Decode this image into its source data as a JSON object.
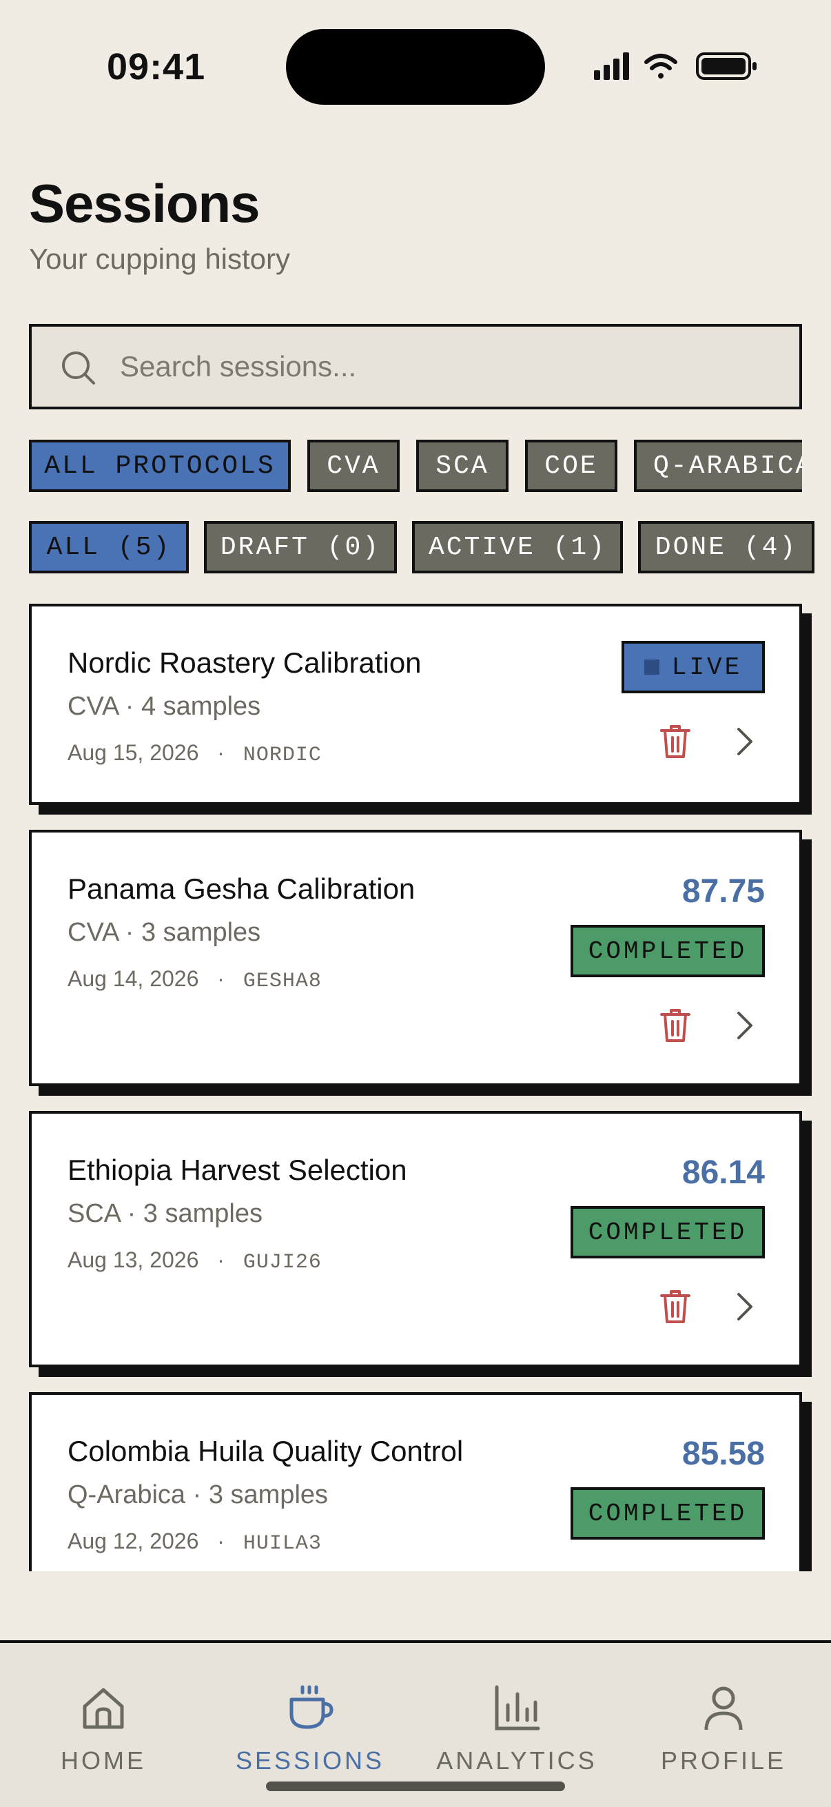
{
  "status_bar": {
    "time": "09:41"
  },
  "header": {
    "title": "Sessions",
    "subtitle": "Your cupping history"
  },
  "search": {
    "placeholder": "Search sessions..."
  },
  "protocol_filters": [
    "ALL PROTOCOLS",
    "CVA",
    "SCA",
    "COE",
    "Q-ARABICA"
  ],
  "status_filters": [
    "ALL (5)",
    "DRAFT (0)",
    "ACTIVE (1)",
    "DONE (4)"
  ],
  "sessions": [
    {
      "title": "Nordic Roastery Calibration",
      "meta": "CVA · 4 samples",
      "date": "Aug 15, 2026",
      "code": "NORDIC",
      "status": "LIVE",
      "score": ""
    },
    {
      "title": "Panama Gesha Calibration",
      "meta": "CVA · 3 samples",
      "date": "Aug 14, 2026",
      "code": "GESHA8",
      "status": "COMPLETED",
      "score": "87.75"
    },
    {
      "title": "Ethiopia Harvest Selection",
      "meta": "SCA · 3 samples",
      "date": "Aug 13, 2026",
      "code": "GUJI26",
      "status": "COMPLETED",
      "score": "86.14"
    },
    {
      "title": "Colombia Huila Quality Control",
      "meta": "Q-Arabica · 3 samples",
      "date": "Aug 12, 2026",
      "code": "HUILA3",
      "status": "COMPLETED",
      "score": "85.58"
    }
  ],
  "date_separator": "·",
  "tabs": [
    "HOME",
    "SESSIONS",
    "ANALYTICS",
    "PROFILE"
  ],
  "colors": {
    "background": "#f0ece4",
    "accent_blue": "#4a73b5",
    "score_blue": "#4a6fa5",
    "completed_green": "#4c9b68",
    "chip_gray": "#6b6a60",
    "delete_red": "#c0504d"
  },
  "icons": {
    "search": "search-icon",
    "delete": "trash-icon",
    "open": "chevron-right-icon",
    "home": "home-icon",
    "sessions": "coffee-cup-icon",
    "analytics": "bar-chart-icon",
    "profile": "person-icon"
  }
}
